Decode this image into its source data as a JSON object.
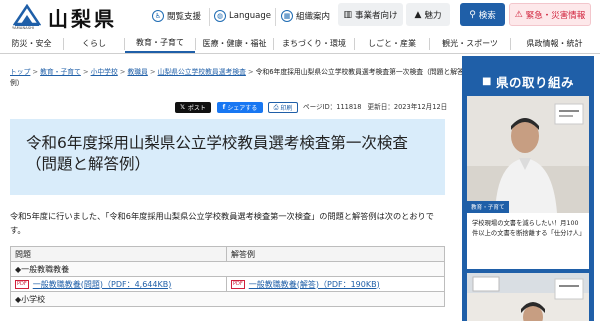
{
  "header": {
    "logo_text": "山梨県",
    "logo_sub": "YAMANASHI",
    "links": [
      {
        "label": "閲覧支援",
        "icon": "accessibility-icon"
      },
      {
        "label": "Language",
        "icon": "globe-icon"
      },
      {
        "label": "組織案内",
        "icon": "building-icon"
      }
    ],
    "business_label": "事業者向け",
    "charm_label": "魅力",
    "search_label": "検索",
    "emergency_label": "緊急・災害情報"
  },
  "nav": {
    "items": [
      "防災・安全",
      "くらし",
      "教育・子育て",
      "医療・健康・福祉",
      "まちづくり・環境",
      "しごと・産業",
      "観光・スポーツ",
      "県政情報・統計"
    ],
    "active_index": 2
  },
  "breadcrumb": {
    "items": [
      "トップ",
      "教育・子育て",
      "小中学校",
      "教職員",
      "山梨県公立学校教員選考検査"
    ],
    "current": "令和6年度採用山梨県公立学校教員選考検査第一次検査（問題と解答例）"
  },
  "share": {
    "x_label": "ポスト",
    "fb_label": "シェアする",
    "print_label": "印刷"
  },
  "meta": {
    "page_id": "ページID：111818",
    "updated": "更新日：2023年12月12日"
  },
  "page_title": "令和6年度採用山梨県公立学校教員選考検査第一次検査（問題と解答例）",
  "intro": "令和5年度に行いました、「令和6年度採用山梨県公立学校教員選考検査第一次検査」の問題と解答例は次のとおりです。",
  "table": {
    "headers": [
      "問題",
      "解答例"
    ],
    "section1": "◆一般教職教養",
    "pdf_badge": "PDF",
    "q1": "一般教職教養(問題)（PDF：4,644KB)",
    "a1": "一般教職教養(解答)（PDF：190KB)",
    "section2": "◆小学校"
  },
  "sidebar": {
    "title": "県の取り組み",
    "card1_tag": "教育・子育て",
    "card1_caption": "学校現場の文書を減らしたい！月100件以上の文書を断捨離する「仕分け人」",
    "colors": {
      "accent": "#1f5fa8",
      "emergency": "#d0203a",
      "title_bg": "#d9ecfa"
    }
  }
}
